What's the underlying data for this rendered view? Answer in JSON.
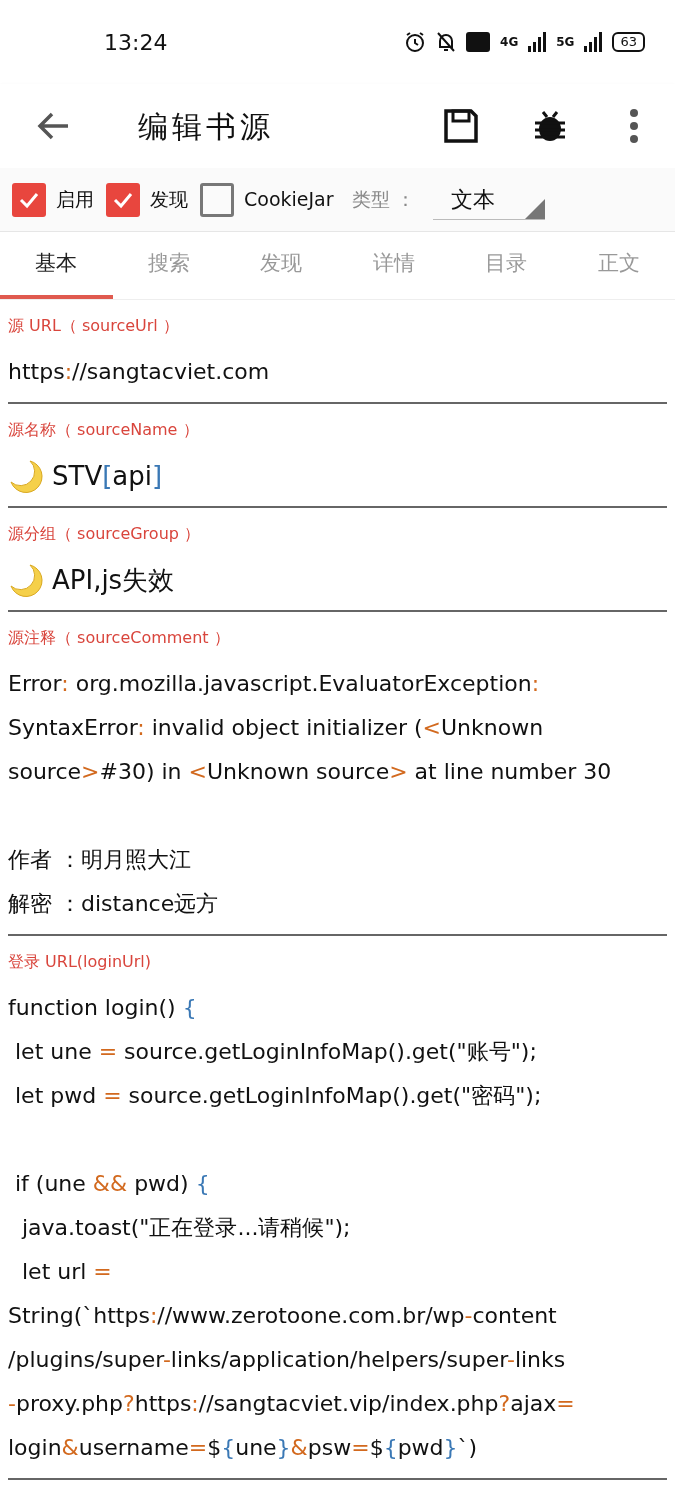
{
  "status_bar": {
    "time": "13:24",
    "network_1": "4G",
    "network_2": "5G",
    "battery": "63"
  },
  "toolbar": {
    "title": "编辑书源"
  },
  "options": {
    "checkboxes": [
      {
        "label": "启用",
        "checked": true
      },
      {
        "label": "发现",
        "checked": true
      },
      {
        "label": "CookieJar",
        "checked": false
      }
    ],
    "type_label": "类型 ：",
    "type_value": "文本"
  },
  "tabs": [
    {
      "label": "基本",
      "selected": true
    },
    {
      "label": "搜索",
      "selected": false
    },
    {
      "label": "发现",
      "selected": false
    },
    {
      "label": "详情",
      "selected": false
    },
    {
      "label": "目录",
      "selected": false
    },
    {
      "label": "正文",
      "selected": false
    }
  ],
  "fields": [
    {
      "label": "源 URL（ sourceUrl ）",
      "kind": "plain",
      "paragraphs": [
        [
          "https://sangtacviet.com"
        ]
      ]
    },
    {
      "label": "源名称（ sourceName ）",
      "kind": "emoji",
      "paragraphs": [
        [
          "STV[api]"
        ]
      ]
    },
    {
      "label": "源分组（ sourceGroup ）",
      "kind": "emoji",
      "paragraphs": [
        [
          "API,js失效"
        ]
      ]
    },
    {
      "label": "源注释（ sourceComment ）",
      "kind": "plain",
      "paragraphs": [
        [
          "Error: org.mozilla.javascript.EvaluatorException:",
          "SyntaxError: invalid object initializer (<Unknown",
          "source>#30) in <Unknown source> at line number 30"
        ],
        [
          "作者 ：明月照大江",
          "解密 ：distance远方"
        ]
      ]
    },
    {
      "label": "登录 URL(loginUrl)",
      "kind": "plain",
      "paragraphs": [
        [
          "function login() {",
          " let une = source.getLoginInfoMap().get(\"账号\");",
          " let pwd = source.getLoginInfoMap().get(\"密码\");"
        ],
        [
          " if (une && pwd) {",
          "  java.toast(\"正在登录...请稍候\");",
          "  let url =",
          "String(`https://www.zerotoone.com.br/wp-content",
          "/plugins/super-links/application/helpers/super-links",
          "-proxy.php?https://sangtacviet.vip/index.php?ajax=",
          "login&username=${une}&psw=${pwd}`)"
        ]
      ]
    }
  ]
}
